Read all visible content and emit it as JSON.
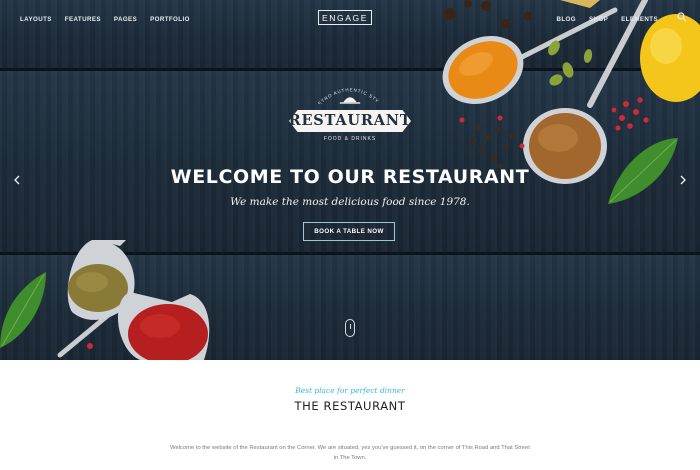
{
  "nav": {
    "left": [
      "LAYOUTS",
      "FEATURES",
      "PAGES",
      "PORTFOLIO"
    ],
    "right": [
      "BLOG",
      "SHOP",
      "ELEMENTS"
    ],
    "logo": "ENGAGE"
  },
  "badge": {
    "top_text": "RETRO AUTHENTIC STYLE",
    "word": "RESTAURANT",
    "sub": "FOOD & DRINKS"
  },
  "hero": {
    "title": "WELCOME TO OUR RESTAURANT",
    "tagline": "We make the most delicious food since 1978.",
    "cta": "BOOK A TABLE NOW"
  },
  "section": {
    "kicker": "Best place for perfect dinner",
    "title": "THE RESTAURANT",
    "welcome": "Welcome to the website of the Restaurant on the Corner. We are situated, yes you've guessed it, on the corner of This Road and That Street in The Town."
  },
  "colors": {
    "accent": "#3ab7d6",
    "wood": "#1d2c3b",
    "text": "#222222"
  },
  "icons": [
    "search-icon",
    "chevron-left-icon",
    "chevron-right-icon",
    "scroll-mouse-icon"
  ]
}
